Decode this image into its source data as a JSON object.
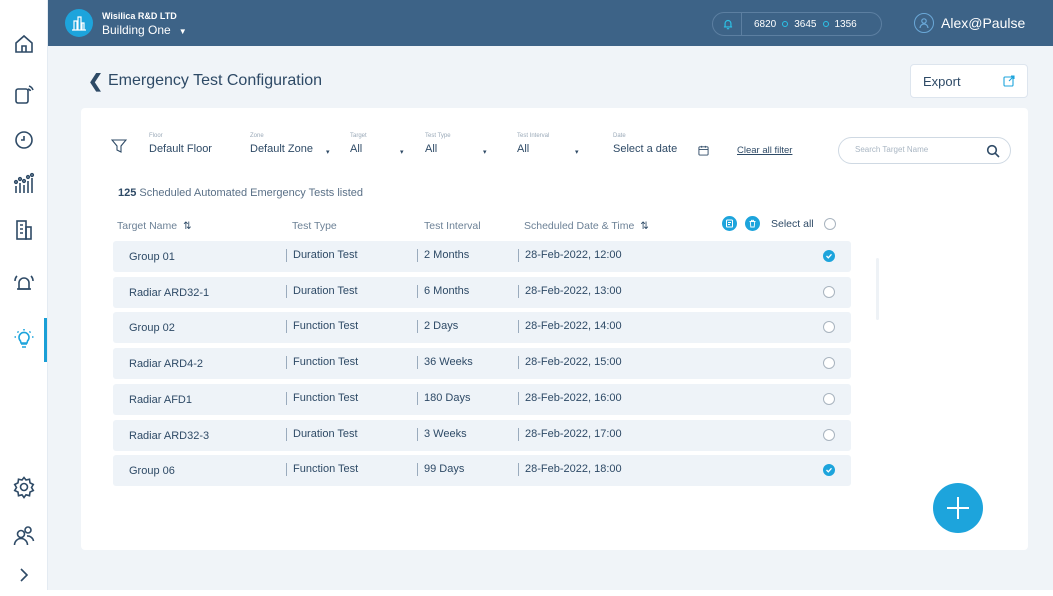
{
  "header": {
    "org_name": "Wisilica R&D LTD",
    "building": "Building One",
    "stats": [
      "6820",
      "3645",
      "1356"
    ],
    "user": "Alex@Paulse"
  },
  "sidebar": {
    "items": [
      {
        "icon": "home-icon"
      },
      {
        "icon": "device-signal-icon"
      },
      {
        "icon": "clock-icon"
      },
      {
        "icon": "analytics-icon"
      },
      {
        "icon": "building-icon"
      },
      {
        "icon": "alert-bell-icon"
      },
      {
        "icon": "lightbulb-icon",
        "active": true
      },
      {
        "icon": "settings-icon"
      },
      {
        "icon": "users-icon"
      },
      {
        "icon": "expand-chevron-icon"
      }
    ]
  },
  "page": {
    "title": "Emergency Test Configuration",
    "export_label": "Export"
  },
  "filters": {
    "floor": {
      "label": "Floor",
      "value": "Default Floor"
    },
    "zone": {
      "label": "Zone",
      "value": "Default Zone"
    },
    "target": {
      "label": "Target",
      "value": "All"
    },
    "test_type": {
      "label": "Test Type",
      "value": "All"
    },
    "test_interval": {
      "label": "Test Interval",
      "value": "All"
    },
    "date": {
      "label": "Date",
      "value": "Select a date"
    },
    "clear_all": "Clear all filter",
    "search_placeholder": "Search Target Name"
  },
  "summary": {
    "count": "125",
    "text": "Scheduled Automated Emergency Tests listed"
  },
  "table": {
    "columns": [
      "Target Name",
      "Test Type",
      "Test Interval",
      "Scheduled Date & Time"
    ],
    "select_all": "Select all",
    "rows": [
      {
        "name": "Group 01",
        "type": "Duration Test",
        "interval": "2 Months",
        "datetime": "28-Feb-2022, 12:00",
        "selected": true
      },
      {
        "name": "Radiar ARD32-1",
        "type": "Duration Test",
        "interval": "6 Months",
        "datetime": "28-Feb-2022, 13:00",
        "selected": false
      },
      {
        "name": "Group 02",
        "type": "Function Test",
        "interval": "2 Days",
        "datetime": "28-Feb-2022, 14:00",
        "selected": false
      },
      {
        "name": "Radiar ARD4-2",
        "type": "Function Test",
        "interval": "36 Weeks",
        "datetime": "28-Feb-2022, 15:00",
        "selected": false
      },
      {
        "name": "Radiar AFD1",
        "type": "Function Test",
        "interval": "180 Days",
        "datetime": "28-Feb-2022, 16:00",
        "selected": false
      },
      {
        "name": "Radiar ARD32-3",
        "type": "Duration Test",
        "interval": "3 Weeks",
        "datetime": "28-Feb-2022, 17:00",
        "selected": false
      },
      {
        "name": "Group 06",
        "type": "Function Test",
        "interval": "99 Days",
        "datetime": "28-Feb-2022, 18:00",
        "selected": true
      }
    ]
  },
  "colors": {
    "accent": "#1da4dc",
    "topbar": "#3d6387",
    "text": "#2e4a66",
    "background": "#f0f4f8"
  }
}
